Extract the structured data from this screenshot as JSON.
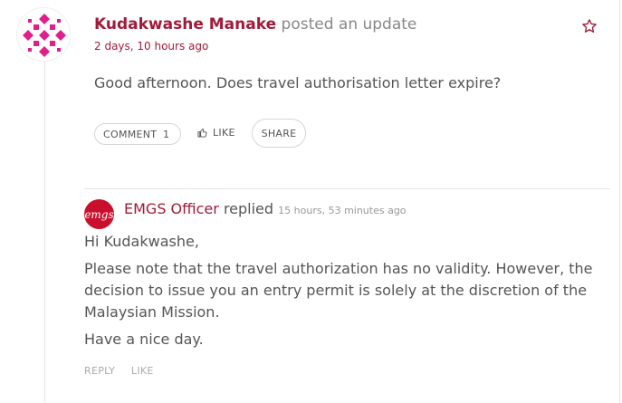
{
  "post": {
    "author_name": "Kudakwashe Manake",
    "action_text": "posted an update",
    "timestamp": "2 days, 10 hours ago",
    "content": "Good afternoon. Does travel authorisation letter expire?",
    "buttons": {
      "comment_label": "COMMENT",
      "comment_count": "1",
      "like_label": "LIKE",
      "share_label": "SHARE"
    },
    "icons": {
      "favorite": "star-outline-icon",
      "like": "thumbs-up-icon"
    }
  },
  "reply": {
    "author_name": "EMGS Officer",
    "avatar_text": "emgs",
    "action_text": "replied",
    "timestamp": "15 hours, 53 minutes ago",
    "paragraphs": [
      "Hi Kudakwashe,",
      "Please note that the travel authorization has no validity. However, the decision to issue you an entry permit is solely at the discretion of the Malaysian Mission.",
      "Have a nice day."
    ],
    "actions": {
      "reply_label": "REPLY",
      "like_label": "LIKE"
    }
  },
  "colors": {
    "accent": "#a11a3a",
    "avatar_pattern": "#e0208a",
    "reply_avatar": "#c8102e"
  }
}
